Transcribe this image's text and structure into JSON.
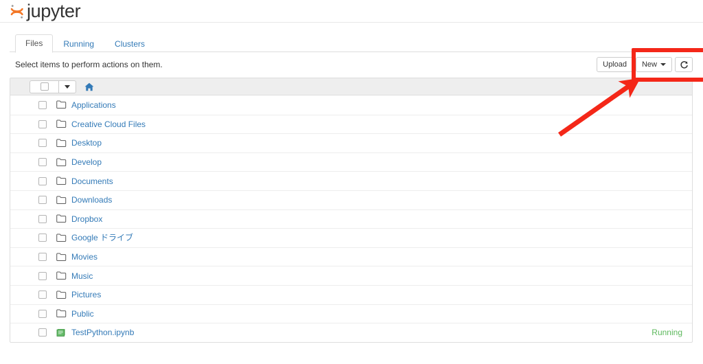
{
  "header": {
    "logo_text": "jupyter",
    "logo_icon": "jupyter-logo-icon"
  },
  "tabs": [
    {
      "label": "Files",
      "active": true,
      "name": "tab-files"
    },
    {
      "label": "Running",
      "active": false,
      "name": "tab-running"
    },
    {
      "label": "Clusters",
      "active": false,
      "name": "tab-clusters"
    }
  ],
  "actions": {
    "hint": "Select items to perform actions on them.",
    "upload_label": "Upload",
    "new_label": "New",
    "refresh_icon": "refresh-icon",
    "new_caret_icon": "caret-down-icon"
  },
  "list_header": {
    "select_all_icon": "checkbox-icon",
    "select_toggle_icon": "caret-down-icon",
    "breadcrumb_icon": "home-icon"
  },
  "files": [
    {
      "name": "Applications",
      "type": "folder",
      "status": ""
    },
    {
      "name": "Creative Cloud Files",
      "type": "folder",
      "status": ""
    },
    {
      "name": "Desktop",
      "type": "folder",
      "status": ""
    },
    {
      "name": "Develop",
      "type": "folder",
      "status": ""
    },
    {
      "name": "Documents",
      "type": "folder",
      "status": ""
    },
    {
      "name": "Downloads",
      "type": "folder",
      "status": ""
    },
    {
      "name": "Dropbox",
      "type": "folder",
      "status": ""
    },
    {
      "name": "Google ドライブ",
      "type": "folder",
      "status": ""
    },
    {
      "name": "Movies",
      "type": "folder",
      "status": ""
    },
    {
      "name": "Music",
      "type": "folder",
      "status": ""
    },
    {
      "name": "Pictures",
      "type": "folder",
      "status": ""
    },
    {
      "name": "Public",
      "type": "folder",
      "status": ""
    },
    {
      "name": "TestPython.ipynb",
      "type": "notebook",
      "status": "Running"
    }
  ],
  "annotation": {
    "highlight_color": "#f42718",
    "box_target": "New",
    "arrow": "points to New button"
  },
  "colors": {
    "link": "#337ab7",
    "running": "#5cb85c",
    "logo_orange": "#f37726",
    "notebook_green": "#4caf50",
    "header_bg": "#eeeeee"
  }
}
